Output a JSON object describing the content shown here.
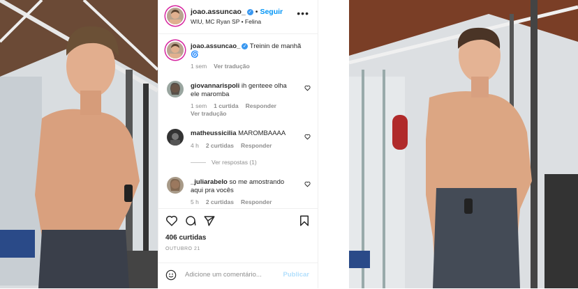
{
  "header": {
    "username": "joao.assuncao_",
    "follow_label": "Seguir",
    "dot": "•",
    "subtitle": "WIU, MC Ryan SP • Felina",
    "more": "•••"
  },
  "caption": {
    "username": "joao.assuncao_",
    "text": "Treinin de manhã",
    "emoji": "🌀",
    "time": "1 sem",
    "translate": "Ver tradução"
  },
  "comments": [
    {
      "username": "giovannarispoli",
      "text_1": "ih genteee olha",
      "text_2": "ele maromba",
      "time": "1 sem",
      "likes": "1 curtida",
      "reply": "Responder",
      "translate": "Ver tradução"
    },
    {
      "username": "matheussicilia",
      "text": "MAROMBAAAA",
      "time": "4 h",
      "likes": "2 curtidas",
      "reply": "Responder"
    },
    {
      "username": "_juliarabelo",
      "text_1": "so me amostrando",
      "text_2": "aqui pra vocês",
      "time": "5 h",
      "likes": "2 curtidas",
      "reply": "Responder"
    }
  ],
  "view_replies": "Ver respostas (1)",
  "likes": "406 curtidas",
  "date": "OUTUBRO 21",
  "add_comment": {
    "placeholder": "Adicione um comentário...",
    "publish": "Publicar"
  },
  "colors": {
    "link_blue": "#0095f6",
    "verified_blue": "#3897f0",
    "muted": "#8e8e8e"
  }
}
